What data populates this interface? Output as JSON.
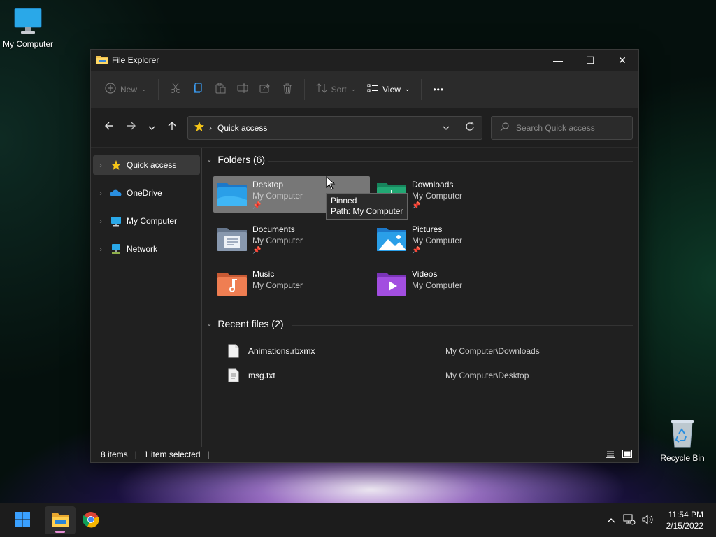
{
  "desktop": {
    "icons": [
      {
        "label": "My Computer",
        "icon": "monitor-icon"
      },
      {
        "label": "Recycle Bin",
        "icon": "recycle-bin-icon"
      }
    ]
  },
  "window": {
    "title": "File Explorer",
    "controls": {
      "minimize": "—",
      "maximize": "☐",
      "close": "✕"
    }
  },
  "toolbar": {
    "new_label": "New",
    "sort_label": "Sort",
    "view_label": "View",
    "more_label": "•••"
  },
  "navbar": {
    "location": "Quick access",
    "search_placeholder": "Search Quick access"
  },
  "sidebar": {
    "items": [
      {
        "label": "Quick access",
        "icon": "star-icon",
        "selected": true
      },
      {
        "label": "OneDrive",
        "icon": "cloud-icon",
        "selected": false
      },
      {
        "label": "My Computer",
        "icon": "monitor-icon",
        "selected": false
      },
      {
        "label": "Network",
        "icon": "network-icon",
        "selected": false
      }
    ]
  },
  "folders": {
    "heading": "Folders (6)",
    "items": [
      {
        "name": "Desktop",
        "location": "My Computer",
        "pinned": true,
        "color": "#2a8fe0"
      },
      {
        "name": "Downloads",
        "location": "My Computer",
        "pinned": true,
        "color": "#1e9e6e"
      },
      {
        "name": "Documents",
        "location": "My Computer",
        "pinned": true,
        "color": "#7a8aa0"
      },
      {
        "name": "Pictures",
        "location": "My Computer",
        "pinned": true,
        "color": "#2a8fe0"
      },
      {
        "name": "Music",
        "location": "My Computer",
        "pinned": false,
        "color": "#e0734a"
      },
      {
        "name": "Videos",
        "location": "My Computer",
        "pinned": false,
        "color": "#9a4ad0"
      }
    ]
  },
  "recent": {
    "heading": "Recent files (2)",
    "items": [
      {
        "name": "Animations.rbxmx",
        "path": "My Computer\\Downloads"
      },
      {
        "name": "msg.txt",
        "path": "My Computer\\Desktop"
      }
    ]
  },
  "tooltip": {
    "line1": "Pinned",
    "line2": "Path: My Computer"
  },
  "status": {
    "items": "8 items",
    "selected": "1 item selected"
  },
  "taskbar": {
    "time": "11:54 PM",
    "date": "2/15/2022"
  }
}
